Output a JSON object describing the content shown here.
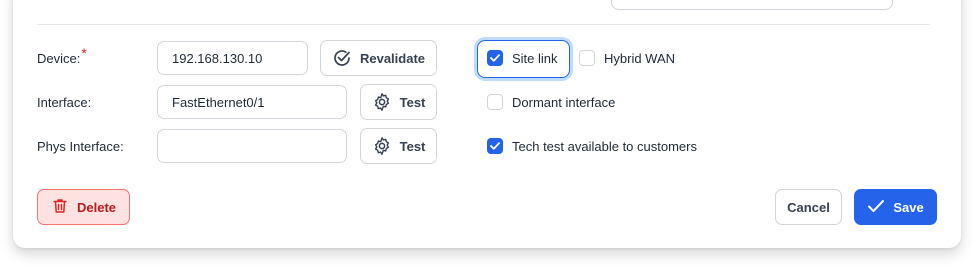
{
  "form": {
    "device": {
      "label": "Device:",
      "required_mark": "*",
      "value": "192.168.130.10",
      "action_label": "Revalidate"
    },
    "interface": {
      "label": "Interface:",
      "value": "FastEthernet0/1",
      "action_label": "Test"
    },
    "phys_interface": {
      "label": "Phys Interface:",
      "value": "",
      "action_label": "Test"
    }
  },
  "options": {
    "site_link": {
      "label": "Site link",
      "checked": true
    },
    "hybrid_wan": {
      "label": "Hybrid WAN",
      "checked": false
    },
    "dormant_interface": {
      "label": "Dormant interface",
      "checked": false
    },
    "tech_test": {
      "label": "Tech test available to customers",
      "checked": true
    }
  },
  "footer": {
    "delete_label": "Delete",
    "cancel_label": "Cancel",
    "save_label": "Save"
  },
  "colors": {
    "primary": "#2563eb",
    "danger": "#dc2626",
    "danger_bg": "#fee2e2"
  },
  "icons": {
    "revalidate": "check-circle-icon",
    "test": "gear-icon",
    "delete": "trash-icon",
    "save": "check-icon",
    "checkbox_checked": "checkmark-icon"
  }
}
